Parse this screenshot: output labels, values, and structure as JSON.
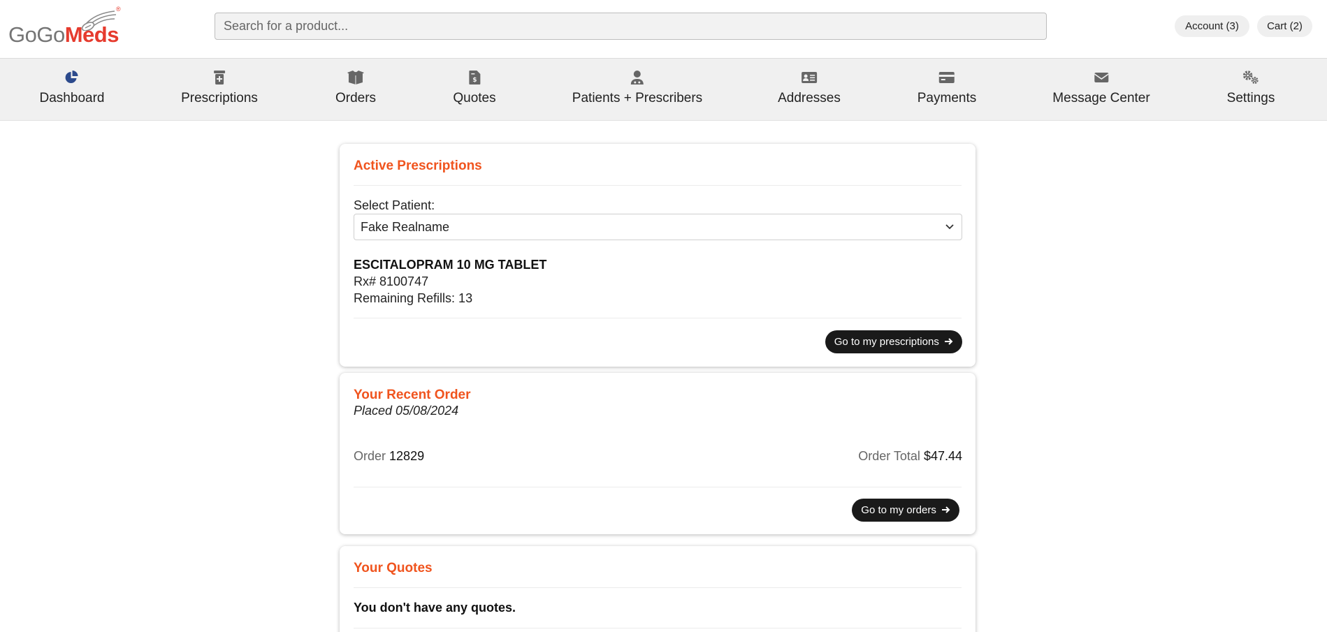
{
  "brand": {
    "logo_part1": "GoGo",
    "logo_part2": "Meds",
    "reg_mark": "®",
    "accent": "#f0541e",
    "logo_red": "#e63b2e"
  },
  "header": {
    "search_placeholder": "Search for a product...",
    "account_label": "Account (3)",
    "cart_label": "Cart (2)"
  },
  "nav": {
    "items": [
      {
        "label": "Dashboard",
        "icon": "pie-chart-icon",
        "active": true
      },
      {
        "label": "Prescriptions",
        "icon": "prescription-bottle-icon"
      },
      {
        "label": "Orders",
        "icon": "box-icon"
      },
      {
        "label": "Quotes",
        "icon": "invoice-dollar-icon"
      },
      {
        "label": "Patients + Prescribers",
        "icon": "doctor-icon"
      },
      {
        "label": "Addresses",
        "icon": "address-card-icon"
      },
      {
        "label": "Payments",
        "icon": "credit-card-icon"
      },
      {
        "label": "Message Center",
        "icon": "envelope-icon"
      },
      {
        "label": "Settings",
        "icon": "gears-icon"
      }
    ]
  },
  "prescriptions": {
    "title": "Active Prescriptions",
    "select_label": "Select Patient:",
    "selected_patient": "Fake Realname",
    "drug_name": "ESCITALOPRAM 10 MG TABLET",
    "rx_number": "Rx# 8100747",
    "refills": "Remaining Refills: 13",
    "button": "Go to my prescriptions"
  },
  "recent_order": {
    "title": "Your Recent Order",
    "placed": "Placed 05/08/2024",
    "order_label": "Order",
    "order_number": "12829",
    "total_label": "Order Total",
    "total_value": "$47.44",
    "button": "Go to my orders"
  },
  "quotes": {
    "title": "Your Quotes",
    "empty_text": "You don't have any quotes."
  }
}
